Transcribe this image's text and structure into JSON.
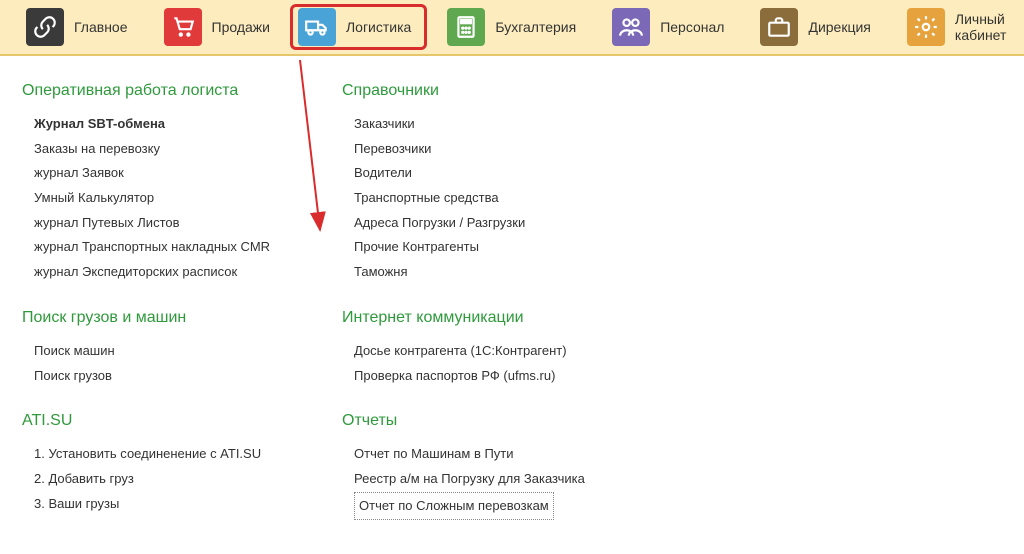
{
  "nav": [
    {
      "label": "Главное"
    },
    {
      "label": "Продажи"
    },
    {
      "label": "Логистика"
    },
    {
      "label": "Бухгалтерия"
    },
    {
      "label": "Персонал"
    },
    {
      "label": "Дирекция"
    },
    {
      "label": "Личный кабинет"
    }
  ],
  "columns": [
    {
      "sections": [
        {
          "title": "Оперативная работа логиста",
          "items": [
            {
              "label": "Журнал SBT-обмена",
              "bold": true
            },
            {
              "label": "Заказы на перевозку"
            },
            {
              "label": "журнал Заявок"
            },
            {
              "label": "Умный Калькулятор"
            },
            {
              "label": "журнал Путевых Листов"
            },
            {
              "label": "журнал Транспортных накладных CMR"
            },
            {
              "label": "журнал Экспедиторских расписок"
            }
          ]
        },
        {
          "title": "Поиск грузов и машин",
          "items": [
            {
              "label": "Поиск машин"
            },
            {
              "label": "Поиск грузов"
            }
          ]
        },
        {
          "title": "ATI.SU",
          "items": [
            {
              "label": "1. Установить соединенение с ATI.SU"
            },
            {
              "label": "2. Добавить груз"
            },
            {
              "label": "3. Ваши грузы"
            }
          ]
        }
      ]
    },
    {
      "sections": [
        {
          "title": "Справочники",
          "items": [
            {
              "label": "Заказчики"
            },
            {
              "label": "Перевозчики"
            },
            {
              "label": "Водители"
            },
            {
              "label": "Транспортные средства"
            },
            {
              "label": "Адреса Погрузки / Разгрузки"
            },
            {
              "label": "Прочие Контрагенты"
            },
            {
              "label": "Таможня"
            }
          ]
        },
        {
          "title": "Интернет коммуникации",
          "items": [
            {
              "label": "Досье контрагента (1С:Контрагент)"
            },
            {
              "label": "Проверка паспортов РФ (ufms.ru)"
            }
          ]
        },
        {
          "title": "Отчеты",
          "items": [
            {
              "label": "Отчет по Машинам в Пути"
            },
            {
              "label": "Реестр а/м на Погрузку для Заказчика"
            },
            {
              "label": "Отчет по Сложным перевозкам",
              "boxed": true
            }
          ]
        }
      ]
    }
  ]
}
